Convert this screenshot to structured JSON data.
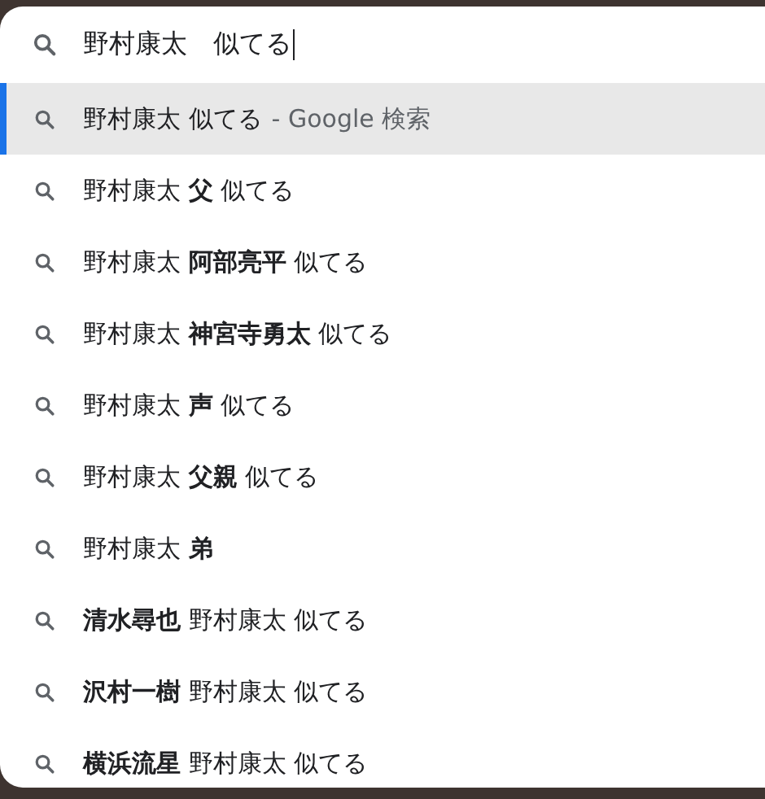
{
  "omnibox": {
    "value": "野村康太　似てる"
  },
  "suggestions": [
    {
      "text": "野村康太 似てる",
      "suffix": "- Google 検索",
      "selected": true
    },
    {
      "text": "野村康太 **父** 似てる",
      "selected": false
    },
    {
      "text": "野村康太 **阿部亮平** 似てる",
      "selected": false
    },
    {
      "text": "野村康太 **神宮寺勇太** 似てる",
      "selected": false
    },
    {
      "text": "野村康太 **声** 似てる",
      "selected": false
    },
    {
      "text": "野村康太 **父親** 似てる",
      "selected": false
    },
    {
      "text": "野村康太 **弟**",
      "selected": false
    },
    {
      "text": "**清水尋也** 野村康太 似てる",
      "selected": false
    },
    {
      "text": "**沢村一樹** 野村康太 似てる",
      "selected": false
    },
    {
      "text": "**横浜流星** 野村康太 似てる",
      "selected": false
    }
  ]
}
